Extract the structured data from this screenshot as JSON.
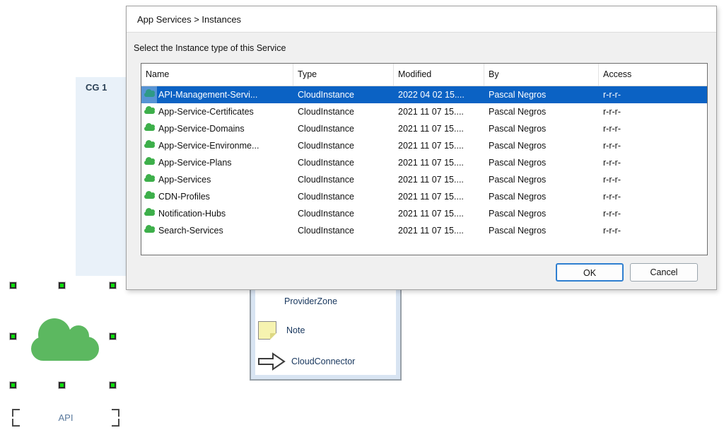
{
  "dialog": {
    "title": "App Services > Instances",
    "subtitle": "Select the Instance type of this Service",
    "table": {
      "columns": [
        "Name",
        "Type",
        "Modified",
        "By",
        "Access"
      ],
      "selected_index": 0,
      "rows": [
        {
          "name": "API-Management-Servi...",
          "type": "CloudInstance",
          "modified": "2022 04 02 15....",
          "by": "Pascal Negros",
          "access": "r-r-r-"
        },
        {
          "name": "App-Service-Certificates",
          "type": "CloudInstance",
          "modified": "2021 11 07 15....",
          "by": "Pascal Negros",
          "access": "r-r-r-"
        },
        {
          "name": "App-Service-Domains",
          "type": "CloudInstance",
          "modified": "2021 11 07 15....",
          "by": "Pascal Negros",
          "access": "r-r-r-"
        },
        {
          "name": "App-Service-Environme...",
          "type": "CloudInstance",
          "modified": "2021 11 07 15....",
          "by": "Pascal Negros",
          "access": "r-r-r-"
        },
        {
          "name": "App-Service-Plans",
          "type": "CloudInstance",
          "modified": "2021 11 07 15....",
          "by": "Pascal Negros",
          "access": "r-r-r-"
        },
        {
          "name": "App-Services",
          "type": "CloudInstance",
          "modified": "2021 11 07 15....",
          "by": "Pascal Negros",
          "access": "r-r-r-"
        },
        {
          "name": "CDN-Profiles",
          "type": "CloudInstance",
          "modified": "2021 11 07 15....",
          "by": "Pascal Negros",
          "access": "r-r-r-"
        },
        {
          "name": "Notification-Hubs",
          "type": "CloudInstance",
          "modified": "2021 11 07 15....",
          "by": "Pascal Negros",
          "access": "r-r-r-"
        },
        {
          "name": "Search-Services",
          "type": "CloudInstance",
          "modified": "2021 11 07 15....",
          "by": "Pascal Negros",
          "access": "r-r-r-"
        }
      ]
    },
    "ok_label": "OK",
    "cancel_label": "Cancel"
  },
  "canvas": {
    "group_label": "CG 1",
    "selected_shape_label": "API"
  },
  "palette": {
    "items": [
      {
        "label": "ProviderZone"
      },
      {
        "label": "Note"
      },
      {
        "label": "CloudConnector"
      }
    ]
  },
  "colors": {
    "selection_blue": "#0b62c4",
    "selected_icon_box_blue": "#5794d4",
    "list_cloud_green": "#3daf4a",
    "selected_cloud_teal": "#2e9a86",
    "big_cloud_green": "#5cb860",
    "handle_green": "#0be00b",
    "group_rect_blue": "#e9f1f9",
    "palette_frame_blue": "#d8e4f2",
    "note_yellow": "#f6f3b0"
  }
}
